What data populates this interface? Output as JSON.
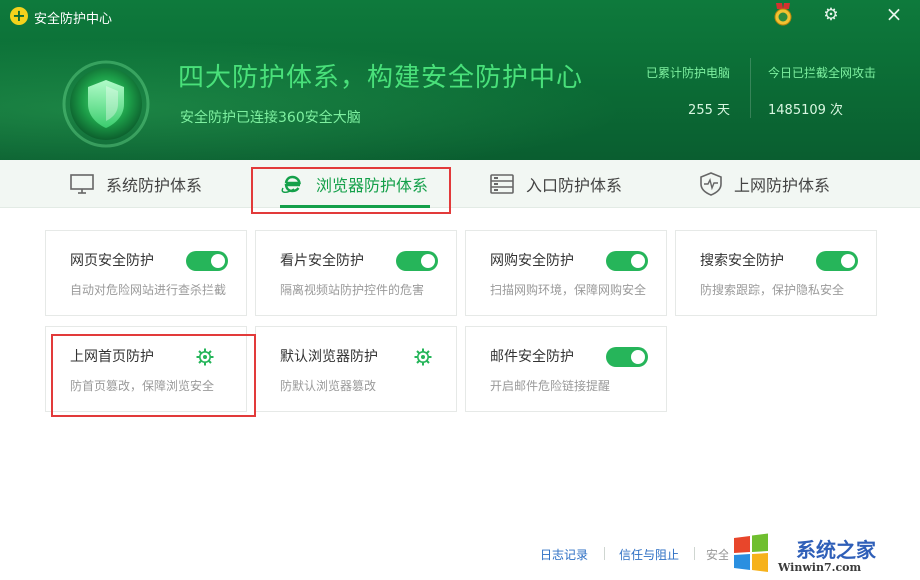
{
  "window": {
    "title": "安全防护中心"
  },
  "hero": {
    "title": "四大防护体系，构建安全防护中心",
    "subtitle": "安全防护已连接360安全大脑"
  },
  "stats": [
    {
      "label": "已累计防护电脑",
      "value": "255 天"
    },
    {
      "label": "今日已拦截全网攻击",
      "value": "1485109 次"
    }
  ],
  "tabs": [
    {
      "label": "系统防护体系",
      "icon": "monitor-icon",
      "active": false
    },
    {
      "label": "浏览器防护体系",
      "icon": "browser-e-icon",
      "active": true
    },
    {
      "label": "入口防护体系",
      "icon": "entry-icon",
      "active": false
    },
    {
      "label": "上网防护体系",
      "icon": "shield-pulse-icon",
      "active": false
    }
  ],
  "cards": [
    {
      "title": "网页安全防护",
      "desc": "自动对危险网站进行查杀拦截",
      "control": "toggle",
      "enabled": true
    },
    {
      "title": "看片安全防护",
      "desc": "隔离视频站防护控件的危害",
      "control": "toggle",
      "enabled": true
    },
    {
      "title": "网购安全防护",
      "desc": "扫描网购环境，保障网购安全",
      "control": "toggle",
      "enabled": true
    },
    {
      "title": "搜索安全防护",
      "desc": "防搜索跟踪，保护隐私安全",
      "control": "toggle",
      "enabled": true
    },
    {
      "title": "上网首页防护",
      "desc": "防首页篡改，保障浏览安全",
      "control": "settings"
    },
    {
      "title": "默认浏览器防护",
      "desc": "防默认浏览器篡改",
      "control": "settings"
    },
    {
      "title": "邮件安全防护",
      "desc": "开启邮件危险链接提醒",
      "control": "toggle",
      "enabled": true
    }
  ],
  "footer": {
    "log": "日志记录",
    "trust_block": "信任与阻止",
    "truncated": "安全"
  },
  "watermark": {
    "text": "系统之家",
    "url": "Winwin7.com"
  },
  "colors": {
    "header_green": "#0b6b35",
    "accent": "#14a04a",
    "toggle_on": "#26b55a",
    "highlight": "#e23a3a",
    "link": "#2d6fc4"
  },
  "icons": {
    "app": "plus-circle-icon",
    "medal": "medal-icon",
    "settings": "gear-icon",
    "close": "close-icon",
    "hero": "green-shield-icon"
  }
}
